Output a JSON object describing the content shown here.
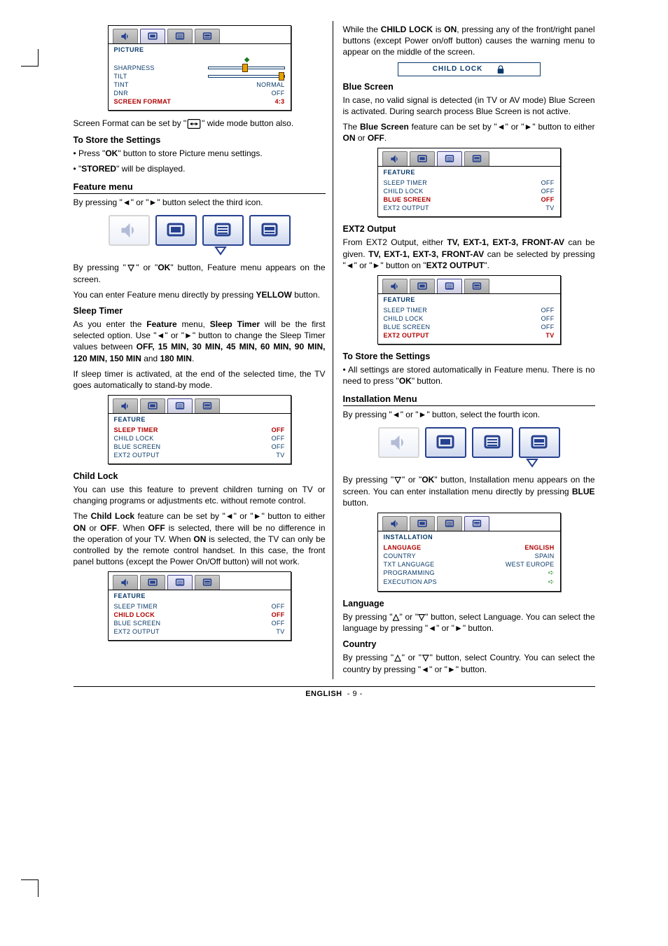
{
  "footer": {
    "lang": "ENGLISH",
    "page": "- 9 -"
  },
  "icons": {
    "left_arrow": "◄",
    "right_arrow": "►",
    "down_arrow": "▽",
    "up_arrow": "△",
    "wide_button": "⟷"
  },
  "left": {
    "picture_menu": {
      "title": "PICTURE",
      "rows": [
        {
          "label": "SHARPNESS",
          "type": "slider",
          "pos": 45
        },
        {
          "label": "TILT",
          "type": "slider",
          "pos": 92
        },
        {
          "label": "TINT",
          "value": "NORMAL"
        },
        {
          "label": "DNR",
          "value": "OFF"
        },
        {
          "label": "SCREEN FORMAT",
          "value": "4:3",
          "selected": true
        }
      ]
    },
    "screen_format_line_a": "Screen Format can be set by \"",
    "screen_format_line_b": "\" wide mode button also.",
    "store_heading": "To Store the Settings",
    "store_b1_a": "• Press \"",
    "store_b1_b": "OK",
    "store_b1_c": "\" button to store Picture menu settings.",
    "store_b2_a": "• \"",
    "store_b2_b": "STORED",
    "store_b2_c": "\" will be displayed.",
    "feature_heading": "Feature menu",
    "feature_intro_a": "By pressing \"",
    "feature_intro_b": "\" or \"",
    "feature_intro_c": "\" button select the third icon.",
    "feature_press_a": "By pressing \"",
    "feature_press_b": "\" or \"",
    "feature_press_c": "OK",
    "feature_press_d": "\" button, Feature menu appears on the screen.",
    "feature_yellow_a": "You can enter Feature menu directly by pressing ",
    "feature_yellow_b": "YELLOW",
    "feature_yellow_c": " button.",
    "sleep_heading": "Sleep Timer",
    "sleep_p1_a": "As you enter the ",
    "sleep_p1_b": "Feature",
    "sleep_p1_c": " menu, ",
    "sleep_p1_d": "Sleep Timer",
    "sleep_p1_e": " will be the first selected option. Use \"",
    "sleep_p1_f": "\" or \"",
    "sleep_p1_g": "\" button to change the Sleep Timer values between ",
    "sleep_p1_h": "OFF, 15 MIN, 30 MIN, 45 MIN, 60 MIN, 90 MIN, 120 MIN, 150 MIN",
    "sleep_p1_i": " and ",
    "sleep_p1_j": "180 MIN",
    "sleep_p1_k": ".",
    "sleep_p2": "If sleep timer is activated, at the end of the selected time, the TV goes automatically to stand-by mode.",
    "feature_menu_sleep": {
      "title": "FEATURE",
      "rows": [
        {
          "label": "SLEEP TIMER",
          "value": "OFF",
          "selected": true
        },
        {
          "label": "CHILD LOCK",
          "value": "OFF"
        },
        {
          "label": "BLUE SCREEN",
          "value": "OFF"
        },
        {
          "label": "EXT2 OUTPUT",
          "value": "TV"
        }
      ]
    },
    "childlock_heading": "Child Lock",
    "childlock_p1": "You can use this feature to prevent children turning on TV or changing programs or adjustments etc. without remote control.",
    "childlock_p2_a": "The ",
    "childlock_p2_b": "Child Lock",
    "childlock_p2_c": " feature can be set by \"",
    "childlock_p2_d": "\" or \"",
    "childlock_p2_e": "\" button to either ",
    "childlock_p2_f": "ON",
    "childlock_p2_g": " or ",
    "childlock_p2_h": "OFF",
    "childlock_p2_i": ". When ",
    "childlock_p2_j": "OFF",
    "childlock_p2_k": " is selected, there will be no difference in the operation of your TV. When ",
    "childlock_p2_l": "ON",
    "childlock_p2_m": " is selected, the TV can only be controlled by the remote control handset. In this case, the front panel buttons (except the Power On/Off button) will not work.",
    "feature_menu_childlock": {
      "title": "FEATURE",
      "rows": [
        {
          "label": "SLEEP TIMER",
          "value": "OFF"
        },
        {
          "label": "CHILD LOCK",
          "value": "OFF",
          "selected": true
        },
        {
          "label": "BLUE SCREEN",
          "value": "OFF"
        },
        {
          "label": "EXT2 OUTPUT",
          "value": "TV"
        }
      ]
    }
  },
  "right": {
    "childlock_on_a": "While the ",
    "childlock_on_b": "CHILD LOCK",
    "childlock_on_c": " is ",
    "childlock_on_d": "ON",
    "childlock_on_e": ", pressing any of the front/right panel buttons (except Power on/off button) causes the warning menu to appear on the middle of the screen.",
    "childlock_banner": "CHILD LOCK",
    "bluescreen_heading": "Blue Screen",
    "bluescreen_p1": "In case, no valid signal is detected (in TV or AV mode) Blue Screen is activated. During search process Blue Screen is not active.",
    "bluescreen_p2_a": "The ",
    "bluescreen_p2_b": "Blue Screen",
    "bluescreen_p2_c": " feature can be set by \"",
    "bluescreen_p2_d": "\" or \"",
    "bluescreen_p2_e": "\" button to either ",
    "bluescreen_p2_f": "ON",
    "bluescreen_p2_g": " or ",
    "bluescreen_p2_h": "OFF",
    "bluescreen_p2_i": ".",
    "feature_menu_blue": {
      "title": "FEATURE",
      "rows": [
        {
          "label": "SLEEP TIMER",
          "value": "OFF"
        },
        {
          "label": "CHILD LOCK",
          "value": "OFF"
        },
        {
          "label": "BLUE SCREEN",
          "value": "OFF",
          "selected": true
        },
        {
          "label": "EXT2 OUTPUT",
          "value": "TV"
        }
      ]
    },
    "ext2_heading": "EXT2 Output",
    "ext2_p1_a": "From EXT2 Output, either ",
    "ext2_p1_b": "TV, EXT-1, EXT-3, FRONT-AV",
    "ext2_p1_c": " can be given. ",
    "ext2_p1_d": "TV, EXT-1, EXT-3, FRONT-AV",
    "ext2_p1_e": " can be selected by pressing \"",
    "ext2_p1_f": "\" or \"",
    "ext2_p1_g": "\" button on \"",
    "ext2_p1_h": "EXT2 OUTPUT",
    "ext2_p1_i": "\".",
    "feature_menu_ext2": {
      "title": "FEATURE",
      "rows": [
        {
          "label": "SLEEP TIMER",
          "value": "OFF"
        },
        {
          "label": "CHILD LOCK",
          "value": "OFF"
        },
        {
          "label": "BLUE SCREEN",
          "value": "OFF"
        },
        {
          "label": "EXT2 OUTPUT",
          "value": "TV",
          "selected": true
        }
      ]
    },
    "store_heading": "To Store the Settings",
    "store_p_a": "• All settings are stored automatically in Feature menu. There is no need to press \"",
    "store_p_b": "OK",
    "store_p_c": "\" button.",
    "install_heading": "Installation Menu",
    "install_intro_a": "By pressing \"",
    "install_intro_b": "\" or \"",
    "install_intro_c": "\" button, select the fourth icon.",
    "install_press_a": "By pressing \"",
    "install_press_b": "\" or \"",
    "install_press_c": "OK",
    "install_press_d": "\" button, Installation menu appears on the screen. You can enter installation menu directly by pressing ",
    "install_press_e": "BLUE",
    "install_press_f": " button.",
    "install_menu": {
      "title": "INSTALLATION",
      "rows": [
        {
          "label": "LANGUAGE",
          "value": "ENGLISH",
          "selected": true
        },
        {
          "label": "COUNTRY",
          "value": "SPAIN"
        },
        {
          "label": "TXT LANGUAGE",
          "value": "WEST EUROPE"
        },
        {
          "label": "PROGRAMMING",
          "arrow": true
        },
        {
          "label": "EXECUTION APS",
          "arrow": true
        }
      ]
    },
    "language_heading": "Language",
    "language_p_a": "By pressing \"",
    "language_p_b": "\" or \"",
    "language_p_c": "\" button, select Language. You can select the language by pressing \"",
    "language_p_d": "\" or \"",
    "language_p_e": "\" button.",
    "country_heading": "Country",
    "country_p_a": "By pressing \"",
    "country_p_b": "\" or \"",
    "country_p_c": "\" button, select Country. You can select the country by pressing \"",
    "country_p_d": "\" or \"",
    "country_p_e": "\" button."
  }
}
